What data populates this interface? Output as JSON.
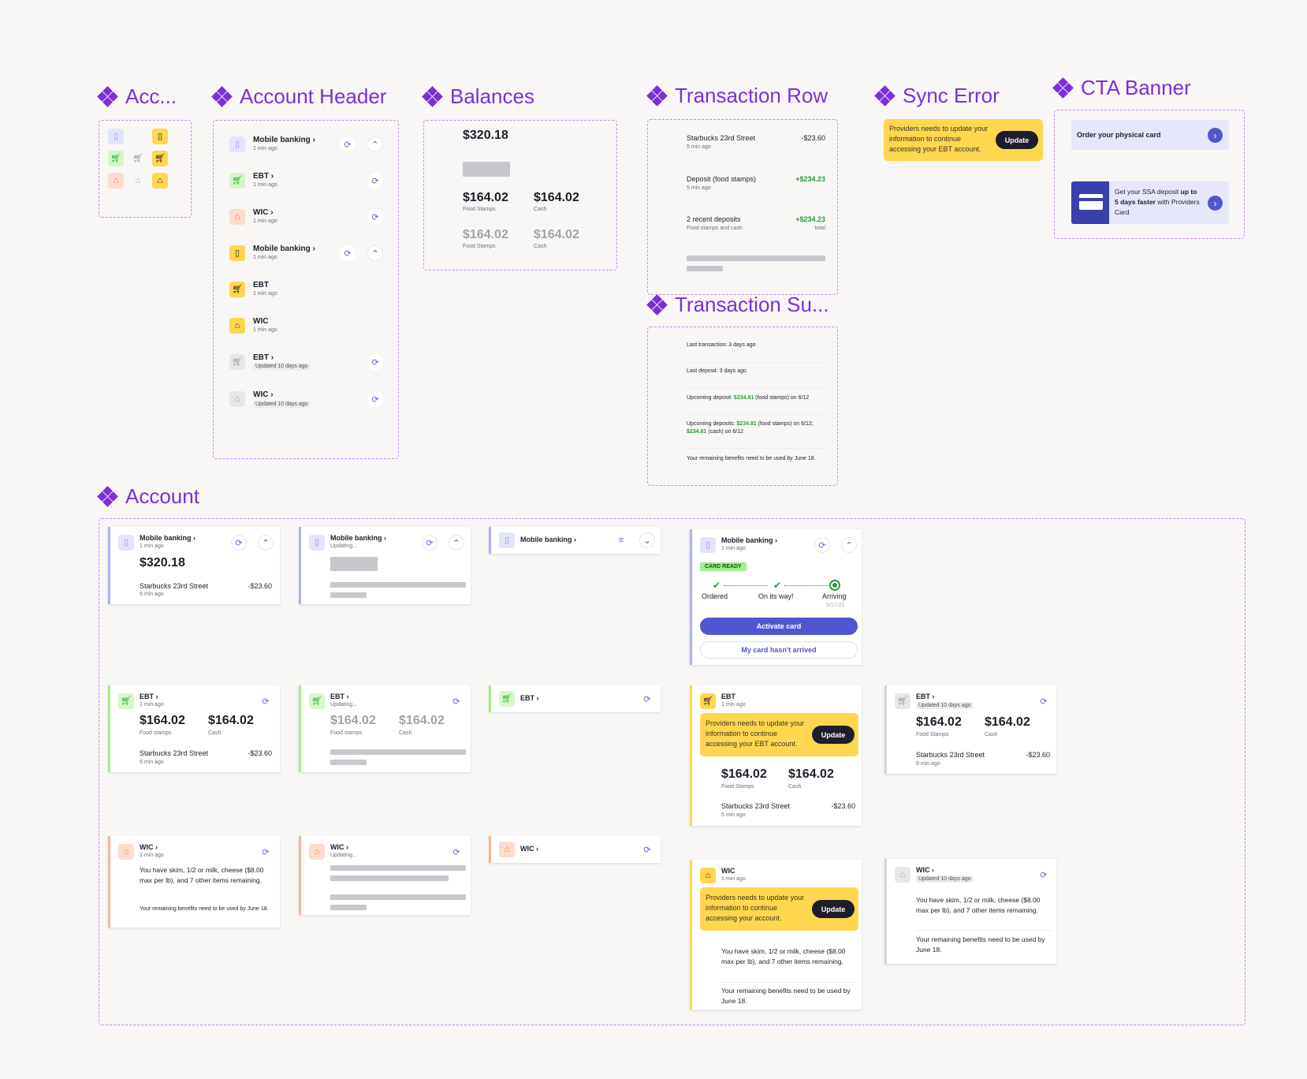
{
  "titles": {
    "account_icon": "Acc...",
    "account_header": "Account Header",
    "balances": "Balances",
    "transaction_row": "Transaction Row",
    "sync_error": "Sync Error",
    "cta_banner": "CTA Banner",
    "transaction_summary": "Transaction Su...",
    "account": "Account"
  },
  "common": {
    "mobile_banking": "Mobile banking",
    "ebt": "EBT",
    "wic": "WIC",
    "min_ago": "1 min ago",
    "updating": "Updating...",
    "updated_10": "Updated 10 days ago",
    "chevron": "›"
  },
  "balances": {
    "total": "$320.18",
    "food": "$164.02",
    "cash": "$164.02",
    "food_label": "Food Stamps",
    "food_label_lower": "Food stamps",
    "cash_label": "Cash"
  },
  "transactions": {
    "starbucks": "Starbucks 23rd Street",
    "starbucks_amt": "-$23.60",
    "five_min": "5 min ago",
    "deposit": "Deposit (food stamps)",
    "deposit_amt": "+$234.23",
    "recent": "2 recent deposits",
    "recent_sub": "Food stamps and cash",
    "recent_amt": "+$234.23",
    "recent_total": "total"
  },
  "sync_error": {
    "message": "Providers needs to update your information to continue accessing your EBT account.",
    "message_generic": "Providers needs to update your information to continue accessing your account.",
    "button": "Update"
  },
  "cta": {
    "physical": "Order your physical card",
    "ssa_pre": "Get your SSA deposit ",
    "ssa_bold": "up to 5 days faster",
    "ssa_post": " with Providers Card"
  },
  "summary": {
    "last_tx": "Last transaction: 3 days ago",
    "last_deposit": "Last deposit: 3 days ago",
    "upcoming_pre": "Upcoming deposit: ",
    "upcoming_amt": "$234.81",
    "upcoming_post": " (food stamps) on 6/12",
    "upcomings_pre": "Upcoming deposits: ",
    "upcomings_amt1": "$234.81",
    "upcomings_mid": " (food stamps) on 6/12; ",
    "upcomings_amt2": "$234.81",
    "upcomings_post": " (cash) on 6/12",
    "remaining": "Your remaining benefits need to be used by June 18."
  },
  "wic": {
    "items": "You have skim, 1/2 or milk, cheese ($8.00 max per lb), and 7 other items remaining.",
    "remaining": "Your remaining benefits need to be used by June 18."
  },
  "card_status": {
    "badge": "CARD READY",
    "step1": "Ordered",
    "step2": "On its way!",
    "step3": "Arriving",
    "step3_date": "5/17/21",
    "activate": "Activate card",
    "not_arrived": "My card hasn't arrived"
  },
  "icons": {
    "mobile_banking": "phone-icon",
    "ebt": "cart-icon",
    "wic": "basket-icon",
    "sync": "refresh-icon",
    "collapse": "chevron-up-icon",
    "expand": "chevron-down-icon",
    "list": "list-icon",
    "next": "chevron-right-icon"
  },
  "colors": {
    "purple_title": "#7b2fd9",
    "indigo": "#5156cf",
    "yellow": "#ffd64f",
    "green": "#2a9a3e"
  }
}
